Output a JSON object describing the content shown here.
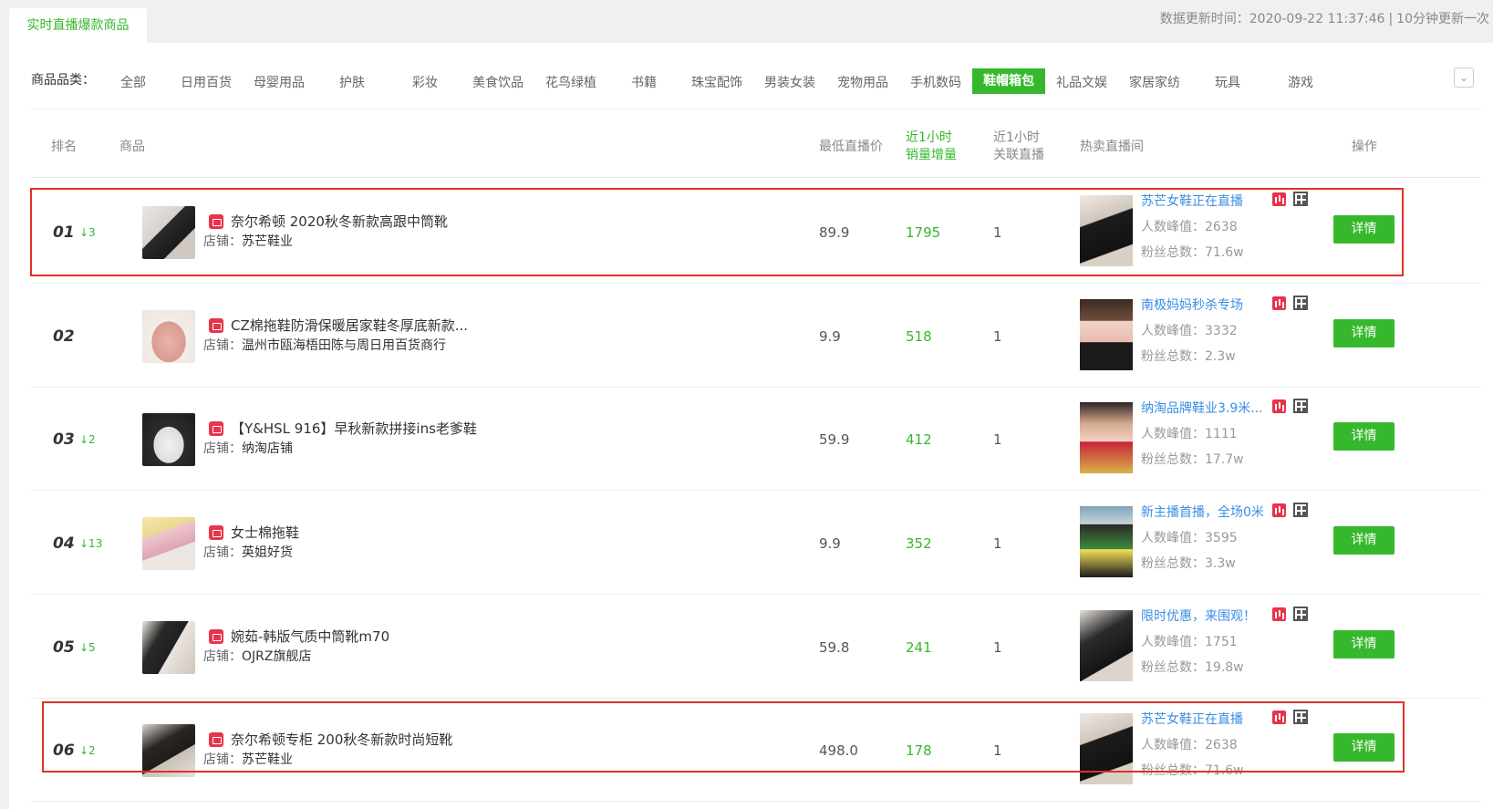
{
  "tab": {
    "label": "实时直播爆款商品"
  },
  "update": {
    "label": "数据更新时间：",
    "time": "2020-09-22 11:37:46",
    "interval": "10分钟更新一次"
  },
  "categories": {
    "label": "商品品类：",
    "items": [
      "全部",
      "日用百货",
      "母婴用品",
      "护肤",
      "彩妆",
      "美食饮品",
      "花鸟绿植",
      "书籍",
      "珠宝配饰",
      "男装女装",
      "宠物用品",
      "手机数码",
      "鞋帽箱包",
      "礼品文娱",
      "家居家纺",
      "玩具",
      "游戏"
    ],
    "active": "鞋帽箱包"
  },
  "table": {
    "headers": {
      "rank": "排名",
      "product": "商品",
      "price": "最低直播价",
      "sales1": "近1小时",
      "sales2": "销量增量",
      "live1": "近1小时",
      "live2": "关联直播",
      "hot": "热卖直播间",
      "action": "操作"
    },
    "shop_label": "店铺：",
    "viewers_label": "人数峰值：",
    "fans_label": "粉丝总数：",
    "detail_label": "详情",
    "rows": [
      {
        "rank": "01",
        "change": "↓3",
        "title": "奈尔希顿 2020秋冬新款高跟中筒靴",
        "shop": "苏芒鞋业",
        "price": "89.9",
        "sales": "1795",
        "lives": "1",
        "live_name": "苏芒女鞋正在直播",
        "viewers": "2638",
        "fans": "71.6w"
      },
      {
        "rank": "02",
        "change": "",
        "title": "CZ棉拖鞋防滑保暖居家鞋冬厚底新款...",
        "shop": "温州市瓯海梧田陈与周日用百货商行",
        "price": "9.9",
        "sales": "518",
        "lives": "1",
        "live_name": "南极妈妈秒杀专场",
        "viewers": "3332",
        "fans": "2.3w"
      },
      {
        "rank": "03",
        "change": "↓2",
        "title": "【Y&HSL 916】早秋新款拼接ins老爹鞋",
        "shop": "纳淘店铺",
        "price": "59.9",
        "sales": "412",
        "lives": "1",
        "live_name": "纳淘品牌鞋业3.9米...",
        "viewers": "1111",
        "fans": "17.7w"
      },
      {
        "rank": "04",
        "change": "↓13",
        "title": "女士棉拖鞋",
        "shop": "英姐好货",
        "price": "9.9",
        "sales": "352",
        "lives": "1",
        "live_name": "新主播首播，全场0米",
        "viewers": "3595",
        "fans": "3.3w"
      },
      {
        "rank": "05",
        "change": "↓5",
        "title": "婉茹-韩版气质中筒靴m70",
        "shop": "OJRZ旗舰店",
        "price": "59.8",
        "sales": "241",
        "lives": "1",
        "live_name": "限时优惠，来围观！",
        "viewers": "1751",
        "fans": "19.8w"
      },
      {
        "rank": "06",
        "change": "↓2",
        "title": "奈尔希顿专柜 200秋冬新款时尚短靴",
        "shop": "苏芒鞋业",
        "price": "498.0",
        "sales": "178",
        "lives": "1",
        "live_name": "苏芒女鞋正在直播",
        "viewers": "2638",
        "fans": "71.6w"
      }
    ]
  },
  "colors": {
    "accent": "#36b82c",
    "link": "#3a8ee6",
    "highlight": "#e0302c",
    "shop_icon": "#e8334a"
  }
}
